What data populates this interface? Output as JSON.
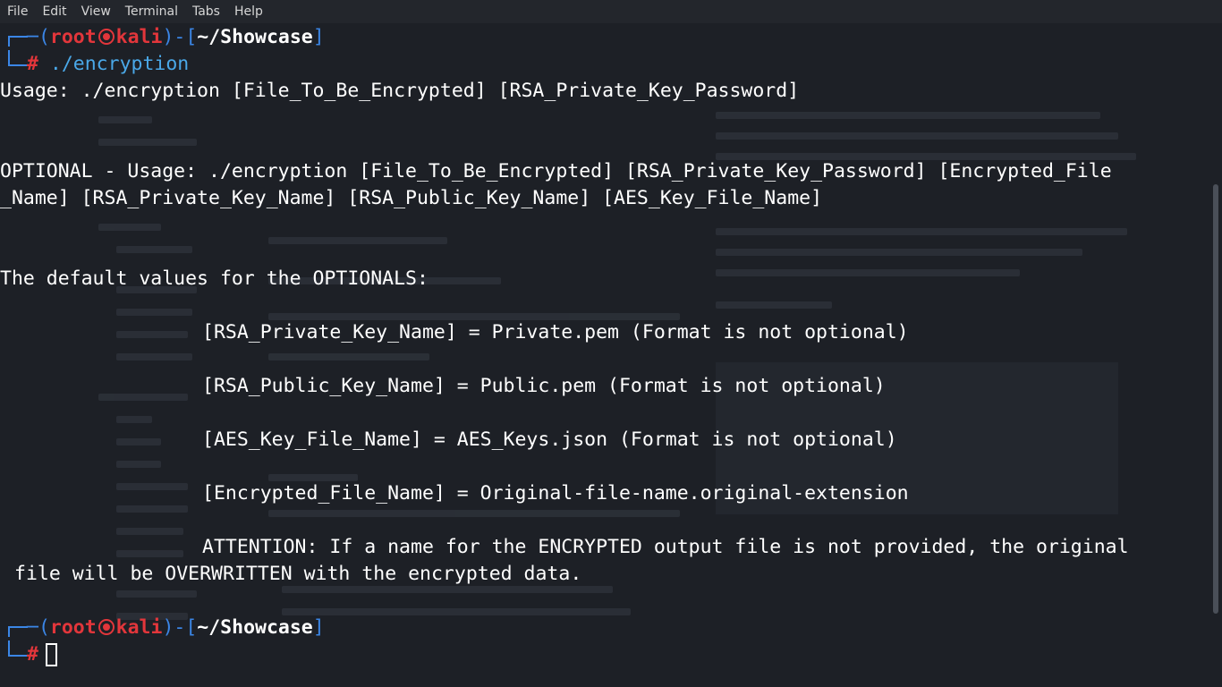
{
  "menu": [
    "File",
    "Edit",
    "View",
    "Terminal",
    "Tabs",
    "Help"
  ],
  "prompt": {
    "user": "root",
    "host": "kali",
    "cwd": "~/Showcase",
    "symbol": "#"
  },
  "command": "./encryption",
  "output": {
    "usage": "Usage: ./encryption [File_To_Be_Encrypted] [RSA_Private_Key_Password]",
    "optional_1": "OPTIONAL - Usage: ./encryption [File_To_Be_Encrypted] [RSA_Private_Key_Password] [Encrypted_File",
    "optional_2": "_Name] [RSA_Private_Key_Name] [RSA_Public_Key_Name] [AES_Key_File_Name]",
    "defaults_header": "The default values for the OPTIONALS:",
    "default_private": "[RSA_Private_Key_Name] = Private.pem (Format is not optional)",
    "default_public": "[RSA_Public_Key_Name] = Public.pem (Format is not optional)",
    "default_aes": "[AES_Key_File_Name] = AES_Keys.json (Format is not optional)",
    "default_encrypted": "[Encrypted_File_Name] = Original-file-name.original-extension",
    "attention_1": "ATTENTION: If a name for the ENCRYPTED output file is not provided, the original",
    "attention_2": "file will be OVERWRITTEN with the encrypted data."
  }
}
